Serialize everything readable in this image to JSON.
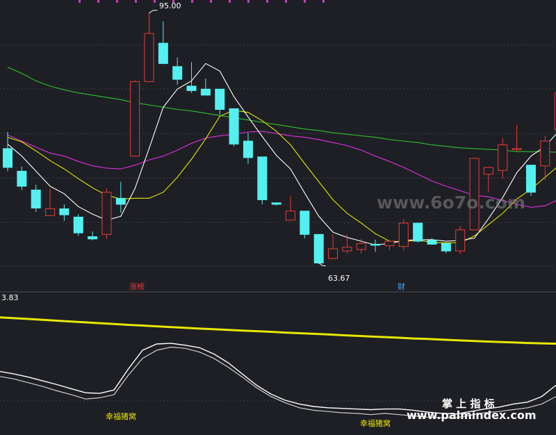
{
  "chart_data": [
    {
      "type": "candlestick",
      "panel": "main",
      "ylim": [
        60,
        96
      ],
      "grid": true,
      "colors": {
        "up": "#e83a3a",
        "down": "#54f0f0",
        "ma5": "#ffffff",
        "ma10": "#e6e600",
        "ma20": "#e030e0",
        "ma60": "#2ec02e"
      },
      "candles": [
        {
          "o": 77.0,
          "h": 79.2,
          "l": 74.0,
          "c": 74.5
        },
        {
          "o": 74.0,
          "h": 74.6,
          "l": 71.5,
          "c": 72.0
        },
        {
          "o": 71.5,
          "h": 72.2,
          "l": 68.6,
          "c": 69.1
        },
        {
          "o": 68.1,
          "h": 71.7,
          "l": 68.1,
          "c": 69.0
        },
        {
          "o": 69.0,
          "h": 69.6,
          "l": 67.4,
          "c": 68.2
        },
        {
          "o": 67.9,
          "h": 68.3,
          "l": 65.4,
          "c": 65.8
        },
        {
          "o": 65.3,
          "h": 66.0,
          "l": 64.8,
          "c": 65.0
        },
        {
          "o": 65.6,
          "h": 71.7,
          "l": 65.0,
          "c": 71.2
        },
        {
          "o": 70.4,
          "h": 72.6,
          "l": 68.5,
          "c": 69.6
        },
        {
          "o": 76.0,
          "h": 86.1,
          "l": 76.0,
          "c": 85.9
        },
        {
          "o": 85.9,
          "h": 95.0,
          "l": 85.9,
          "c": 92.3
        },
        {
          "o": 91.0,
          "h": 93.9,
          "l": 88.2,
          "c": 88.3
        },
        {
          "o": 87.9,
          "h": 89.1,
          "l": 85.5,
          "c": 86.2
        },
        {
          "o": 85.3,
          "h": 88.5,
          "l": 84.4,
          "c": 84.7
        },
        {
          "o": 84.9,
          "h": 86.3,
          "l": 84.1,
          "c": 84.1
        },
        {
          "o": 84.9,
          "h": 84.9,
          "l": 81.5,
          "c": 82.2
        },
        {
          "o": 82.3,
          "h": 82.3,
          "l": 77.3,
          "c": 77.6
        },
        {
          "o": 78.0,
          "h": 79.1,
          "l": 75.0,
          "c": 75.8
        },
        {
          "o": 75.9,
          "h": 75.9,
          "l": 69.6,
          "c": 70.2
        },
        {
          "o": 69.8,
          "h": 69.8,
          "l": 69.4,
          "c": 69.6
        },
        {
          "o": 67.5,
          "h": 70.7,
          "l": 67.5,
          "c": 68.7
        },
        {
          "o": 68.7,
          "h": 68.7,
          "l": 65.1,
          "c": 65.6
        },
        {
          "o": 65.6,
          "h": 65.6,
          "l": 61.7,
          "c": 61.8
        },
        {
          "o": 62.4,
          "h": 65.6,
          "l": 62.3,
          "c": 63.7
        },
        {
          "o": 63.4,
          "h": 65.6,
          "l": 63.1,
          "c": 63.9
        },
        {
          "o": 63.6,
          "h": 65.0,
          "l": 63.1,
          "c": 64.4
        },
        {
          "o": 64.3,
          "h": 64.9,
          "l": 63.3,
          "c": 64.2
        },
        {
          "o": 64.1,
          "h": 64.9,
          "l": 63.5,
          "c": 64.7
        },
        {
          "o": 64.0,
          "h": 67.6,
          "l": 63.5,
          "c": 67.1
        },
        {
          "o": 67.1,
          "h": 67.1,
          "l": 64.5,
          "c": 64.7
        },
        {
          "o": 64.8,
          "h": 65.1,
          "l": 64.2,
          "c": 64.3
        },
        {
          "o": 64.4,
          "h": 64.4,
          "l": 63.1,
          "c": 63.4
        },
        {
          "o": 63.4,
          "h": 66.7,
          "l": 63.0,
          "c": 66.2
        },
        {
          "o": 66.2,
          "h": 75.7,
          "l": 66.2,
          "c": 75.7
        },
        {
          "o": 73.6,
          "h": 74.6,
          "l": 71.2,
          "c": 74.5
        },
        {
          "o": 74.1,
          "h": 78.4,
          "l": 73.0,
          "c": 77.5
        },
        {
          "o": 77.0,
          "h": 80.1,
          "l": 76.6,
          "c": 77.0
        },
        {
          "o": 74.8,
          "h": 74.8,
          "l": 70.7,
          "c": 71.2
        },
        {
          "o": 74.7,
          "h": 78.7,
          "l": 72.8,
          "c": 78.0
        },
        {
          "o": 79.5,
          "h": 85.0,
          "l": 79.1,
          "c": 84.4
        }
      ],
      "ma5": [
        77.6,
        76.0,
        74.0,
        72.0,
        71.0,
        69.3,
        68.3,
        67.5,
        68.0,
        71.7,
        77.0,
        82.5,
        84.9,
        86.0,
        88.3,
        87.3,
        83.9,
        81.2,
        78.6,
        76.1,
        74.3,
        71.1,
        68.0,
        65.9,
        65.2,
        64.7,
        64.2,
        64.4,
        64.8,
        64.9,
        64.9,
        64.7,
        64.8,
        65.1,
        67.7,
        70.5,
        73.8,
        76.0,
        77.3,
        79.4
      ],
      "ma10": [
        78.5,
        77.9,
        76.7,
        75.4,
        74.3,
        73.0,
        71.8,
        70.8,
        70.3,
        70.4,
        70.4,
        71.2,
        73.2,
        75.6,
        78.3,
        81.3,
        82.1,
        81.8,
        80.7,
        79.3,
        77.5,
        75.0,
        72.6,
        70.2,
        68.4,
        67.1,
        65.7,
        64.7,
        64.6,
        64.9,
        64.5,
        64.5,
        64.5,
        65.4,
        66.9,
        68.4,
        70.3,
        71.6,
        73.2,
        74.8
      ],
      "ma20": [
        78.8,
        78.0,
        77.2,
        76.4,
        76.0,
        75.3,
        74.7,
        74.4,
        74.3,
        74.8,
        75.5,
        76.0,
        76.8,
        77.7,
        78.4,
        78.7,
        78.9,
        79.2,
        79.3,
        79.0,
        78.7,
        78.5,
        78.2,
        77.8,
        77.4,
        76.8,
        76.0,
        75.3,
        74.5,
        73.6,
        72.7,
        72.0,
        71.4,
        70.8,
        70.6,
        70.1,
        69.6,
        69.2,
        69.4,
        70.3
      ],
      "ma60": [
        87.8,
        87.0,
        86.0,
        85.3,
        84.8,
        84.4,
        84.1,
        83.8,
        83.5,
        83.1,
        82.8,
        82.5,
        82.2,
        82.0,
        81.7,
        81.4,
        81.1,
        80.8,
        80.5,
        80.2,
        79.9,
        79.6,
        79.4,
        79.1,
        78.9,
        78.7,
        78.5,
        78.2,
        78.0,
        77.8,
        77.5,
        77.3,
        77.1,
        77.0,
        76.9,
        76.8,
        76.6,
        76.6,
        76.6,
        76.5
      ],
      "annotations": {
        "high_label": "95.00",
        "low_label": "63.67",
        "marker_zhangbang": "涨榜",
        "marker_cai": "财"
      }
    },
    {
      "type": "line",
      "panel": "indicator",
      "ylim": [
        0,
        1
      ],
      "value_label": "3.83",
      "series": [
        {
          "color": "#e8e800",
          "width": 3,
          "values": [
            0.862,
            0.856,
            0.85,
            0.843,
            0.836,
            0.829,
            0.823,
            0.816,
            0.81,
            0.803,
            0.797,
            0.791,
            0.785,
            0.779,
            0.773,
            0.768,
            0.762,
            0.757,
            0.752,
            0.747,
            0.741,
            0.736,
            0.731,
            0.726,
            0.72,
            0.715,
            0.71,
            0.705,
            0.7,
            0.694,
            0.69,
            0.685,
            0.68,
            0.675,
            0.67,
            0.666,
            0.662,
            0.658,
            0.655,
            0.652
          ]
        },
        {
          "color": "#ffffff",
          "width": 1.4,
          "values": [
            0.43,
            0.41,
            0.385,
            0.355,
            0.325,
            0.292,
            0.26,
            0.255,
            0.282,
            0.45,
            0.6,
            0.65,
            0.655,
            0.64,
            0.62,
            0.57,
            0.5,
            0.41,
            0.32,
            0.25,
            0.2,
            0.17,
            0.15,
            0.14,
            0.135,
            0.13,
            0.125,
            0.13,
            0.13,
            0.12,
            0.105,
            0.095,
            0.09,
            0.11,
            0.13,
            0.145,
            0.17,
            0.185,
            0.23,
            0.32
          ]
        },
        {
          "color": "#cfcfcf",
          "width": 1.2,
          "values": [
            0.39,
            0.37,
            0.34,
            0.31,
            0.275,
            0.245,
            0.21,
            0.22,
            0.245,
            0.4,
            0.535,
            0.6,
            0.625,
            0.615,
            0.585,
            0.535,
            0.465,
            0.385,
            0.3,
            0.23,
            0.18,
            0.14,
            0.12,
            0.11,
            0.1,
            0.095,
            0.085,
            0.095,
            0.085,
            0.075,
            0.065,
            0.06,
            0.06,
            0.08,
            0.1,
            0.11,
            0.125,
            0.14,
            0.17,
            0.23
          ]
        }
      ],
      "labels": [
        "幸福猪窝",
        "幸福猪窝"
      ]
    }
  ],
  "watermarks": {
    "mid": "www.6o7o.com",
    "bottom_title": "掌 上 指 标",
    "bottom_url": "www.palmindex.com"
  }
}
